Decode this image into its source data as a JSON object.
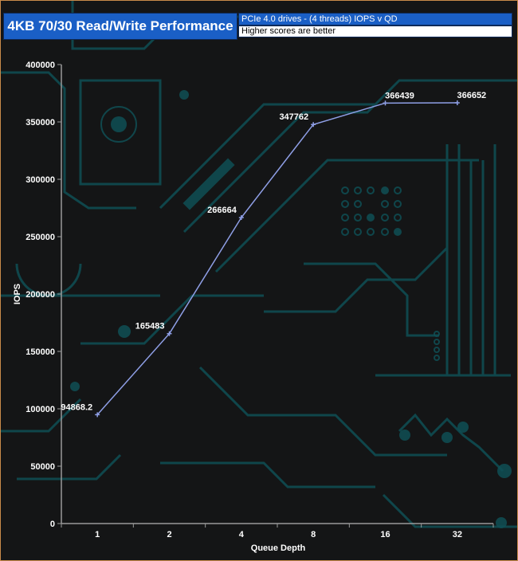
{
  "header": {
    "title": "4KB 70/30 Read/Write Performance",
    "subtitle": "PCIe 4.0 drives - (4 threads) IOPS v QD",
    "note": "Higher scores are better"
  },
  "colors": {
    "title_bg": "#1a5fc6",
    "series_line": "#8f9fe6",
    "background": "#141516",
    "circuit": "#0f4f55",
    "label_text": "#ffffff"
  },
  "chart_data": {
    "type": "line",
    "title": "",
    "xlabel": "Queue Depth",
    "ylabel": "IOPS",
    "categories": [
      "1",
      "2",
      "4",
      "8",
      "16",
      "32"
    ],
    "series": [
      {
        "values": [
          94868.2,
          165483,
          266664,
          347762,
          366439,
          366652
        ],
        "labels": [
          "94868.2",
          "165483",
          "266664",
          "347762",
          "366439",
          "366652"
        ]
      }
    ],
    "yticks": [
      "0",
      "50000",
      "100000",
      "150000",
      "200000",
      "250000",
      "300000",
      "350000",
      "400000"
    ],
    "ylim": [
      0,
      400000
    ],
    "grid": false,
    "legend": "none"
  }
}
